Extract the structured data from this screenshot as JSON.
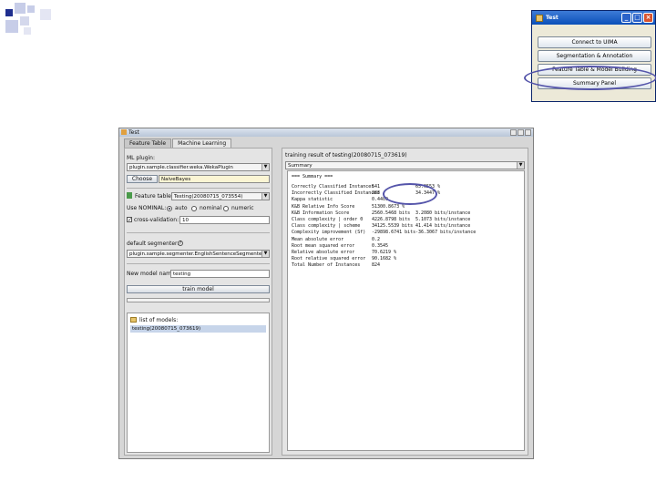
{
  "mini_dialog": {
    "title": "Test",
    "buttons": [
      "Connect to UIMA",
      "Segmentation & Annotation",
      "Feature Table & Model Building",
      "Summary Panel"
    ]
  },
  "window": {
    "title": "Test",
    "tabs": [
      "Feature Table",
      "Machine Learning"
    ]
  },
  "left": {
    "ml_plugin_label": "ML plugin:",
    "ml_plugin_value": "plugin.sample.classifier.weka.WekaPlugin",
    "choose_label": "Choose",
    "classifier_value": "NaiveBayes",
    "feature_table_label": "Feature table:",
    "feature_table_value": "Testing(20080715_073554)",
    "nominal_label": "Use NOMINAL:",
    "auto_label": "auto",
    "nominal_option": "nominal",
    "numeric_option": "numeric",
    "cv_label": "cross-validation:",
    "cv_value": "10",
    "segmenter_label": "default segmenter:",
    "segmenter_value": "plugin.sample.segmenter.EnglishSentenceSegmenter",
    "model_name_label": "New model name:",
    "model_name_value": "testing",
    "train_label": "train model",
    "models_label": "list of models:",
    "models": [
      "testing(20080715_073619)"
    ]
  },
  "right": {
    "result_label": "training result of testing(20080715_073619)",
    "summary_value": "Summary",
    "results_header": "=== Summary ===",
    "result_rows": [
      {
        "k": "Correctly Classified Instances",
        "v": "541",
        "p": "65.6553 %"
      },
      {
        "k": "Incorrectly Classified Instances",
        "v": "283",
        "p": "34.3447 %"
      },
      {
        "k": "Kappa statistic",
        "v": "0.4409",
        "p": ""
      },
      {
        "k": "K&B Relative Info Score",
        "v": "51300.8673 %",
        "p": ""
      },
      {
        "k": "K&B Information Score",
        "v": "2560.5468 bits",
        "p": "3.2080 bits/instance"
      },
      {
        "k": "Class complexity | order 0",
        "v": "4226.8798 bits",
        "p": "5.1073 bits/instance"
      },
      {
        "k": "Class complexity | scheme",
        "v": "34125.5539 bits",
        "p": "41.414 bits/instance"
      },
      {
        "k": "Complexity improvement (Sf)",
        "v": "-29898.6741 bits",
        "p": "-36.3067 bits/instance"
      },
      {
        "k": "Mean absolute error",
        "v": "0.2",
        "p": ""
      },
      {
        "k": "Root mean squared error",
        "v": "0.3545",
        "p": ""
      },
      {
        "k": "Relative absolute error",
        "v": "70.6219 %",
        "p": ""
      },
      {
        "k": "Root relative squared error",
        "v": "90.1682 %",
        "p": ""
      },
      {
        "k": "Total Number of Instances",
        "v": "824",
        "p": ""
      }
    ]
  }
}
